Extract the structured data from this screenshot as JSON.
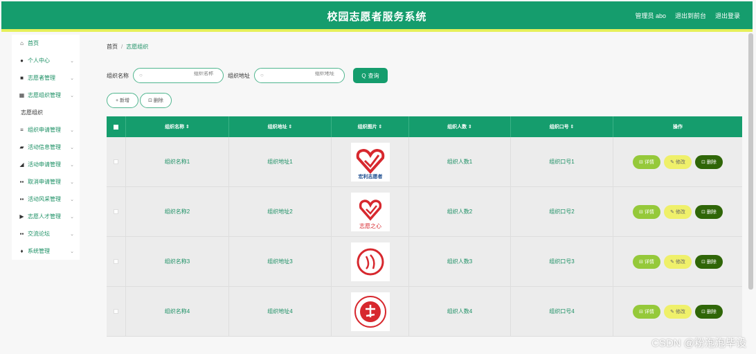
{
  "header": {
    "title": "校园志愿者服务系统",
    "admin": "管理员 abo",
    "to_front": "退出到前台",
    "logout": "退出登录"
  },
  "sidebar": {
    "items": [
      {
        "label": "首页",
        "icon": "home-icon",
        "glyph": "⌂",
        "chev": ""
      },
      {
        "label": "个人中心",
        "icon": "user-icon",
        "glyph": "●",
        "chev": "⌄"
      },
      {
        "label": "志愿者管理",
        "icon": "id-icon",
        "glyph": "■",
        "chev": "⌄"
      },
      {
        "label": "志愿组织管理",
        "icon": "grid-icon",
        "glyph": "▦",
        "chev": "⌄"
      },
      {
        "label": "志愿组织",
        "icon": "",
        "glyph": "",
        "chev": "",
        "active": true
      },
      {
        "label": "组织申请管理",
        "icon": "list-icon",
        "glyph": "≡",
        "chev": "⌄"
      },
      {
        "label": "活动信息管理",
        "icon": "flag-icon",
        "glyph": "▰",
        "chev": "⌄"
      },
      {
        "label": "活动申请管理",
        "icon": "hand-icon",
        "glyph": "◢",
        "chev": "⌄"
      },
      {
        "label": "取消申请管理",
        "icon": "apps-icon",
        "glyph": "▪▪",
        "chev": "⌄"
      },
      {
        "label": "活动风采管理",
        "icon": "apps-icon",
        "glyph": "▪▪",
        "chev": "⌄"
      },
      {
        "label": "志愿人才管理",
        "icon": "flag-icon",
        "glyph": "▶",
        "chev": "⌄"
      },
      {
        "label": "交流论坛",
        "icon": "apps-icon",
        "glyph": "▪▪",
        "chev": "⌄"
      },
      {
        "label": "系统管理",
        "icon": "pin-icon",
        "glyph": "♦",
        "chev": "⌄"
      }
    ]
  },
  "breadcrumb": {
    "home": "首页",
    "sep": "/",
    "current": "志愿组织"
  },
  "search": {
    "name_label": "组织名称",
    "name_placeholder": "组织名称",
    "addr_label": "组织地址",
    "addr_placeholder": "组织地址",
    "query_label": "查询",
    "query_glyph": "Q"
  },
  "actions": {
    "add": "+ 新增",
    "delete": "⊡ 删除"
  },
  "table": {
    "columns": [
      "组织名称 ⇕",
      "组织地址 ⇕",
      "组织图片 ⇕",
      "组织人数 ⇕",
      "组织口号 ⇕",
      "操作"
    ],
    "rows": [
      {
        "name": "组织名称1",
        "addr": "组织地址1",
        "count": "组织人数1",
        "slogan": "组织口号1",
        "img_caption": "宏利志愿者"
      },
      {
        "name": "组织名称2",
        "addr": "组织地址2",
        "count": "组织人数2",
        "slogan": "组织口号2",
        "img_caption": "志愿之心"
      },
      {
        "name": "组织名称3",
        "addr": "组织地址3",
        "count": "组织人数3",
        "slogan": "组织口号3",
        "img_caption": ""
      },
      {
        "name": "组织名称4",
        "addr": "组织地址4",
        "count": "组织人数4",
        "slogan": "组织口号4",
        "img_caption": ""
      }
    ],
    "op_detail": "⊟ 详情",
    "op_edit": "✎ 修改",
    "op_delete": "⊡ 删除"
  },
  "watermark": "CSDN @粉泡泡毕设",
  "colors": {
    "primary": "#159d6d",
    "accent": "#e6f05a",
    "detail": "#95c93a",
    "edit": "#eff06a",
    "delete": "#2f6608",
    "logo_red": "#d7282e"
  }
}
